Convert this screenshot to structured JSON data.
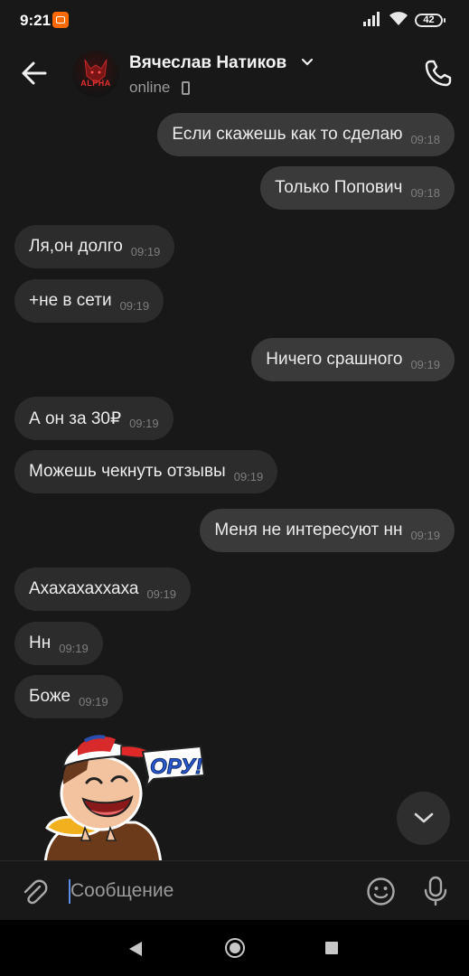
{
  "status_bar": {
    "time": "9:21",
    "battery": "42"
  },
  "header": {
    "contact_name": "Вячеслав Натиков",
    "status": "online",
    "avatar_text": "ALPHA"
  },
  "messages": [
    {
      "direction": "out",
      "text": "Если скажешь как то сделаю",
      "time": "09:18"
    },
    {
      "direction": "out",
      "text": "Только Попович",
      "time": "09:18"
    },
    {
      "direction": "in",
      "text": "Ля,он долго",
      "time": "09:19"
    },
    {
      "direction": "in",
      "text": "+не в сети",
      "time": "09:19"
    },
    {
      "direction": "out",
      "text": "Ничего срашного",
      "time": "09:19"
    },
    {
      "direction": "in",
      "text": "А он за 30₽",
      "time": "09:19"
    },
    {
      "direction": "in",
      "text": "Можешь чекнуть отзывы",
      "time": "09:19"
    },
    {
      "direction": "out",
      "text": "Меня не интересуют нн",
      "time": "09:19"
    },
    {
      "direction": "in",
      "text": "Ахахахаххаха",
      "time": "09:19"
    },
    {
      "direction": "in",
      "text": "Нн",
      "time": "09:19"
    },
    {
      "direction": "in",
      "text": "Боже",
      "time": "09:19"
    }
  ],
  "sticker": {
    "caption": "ОРУ!"
  },
  "composer": {
    "placeholder": "Сообщение"
  },
  "colors": {
    "background": "#181818",
    "bubble_in": "#2c2c2c",
    "bubble_out": "#3a3a3a",
    "caret": "#5c8ee6"
  }
}
